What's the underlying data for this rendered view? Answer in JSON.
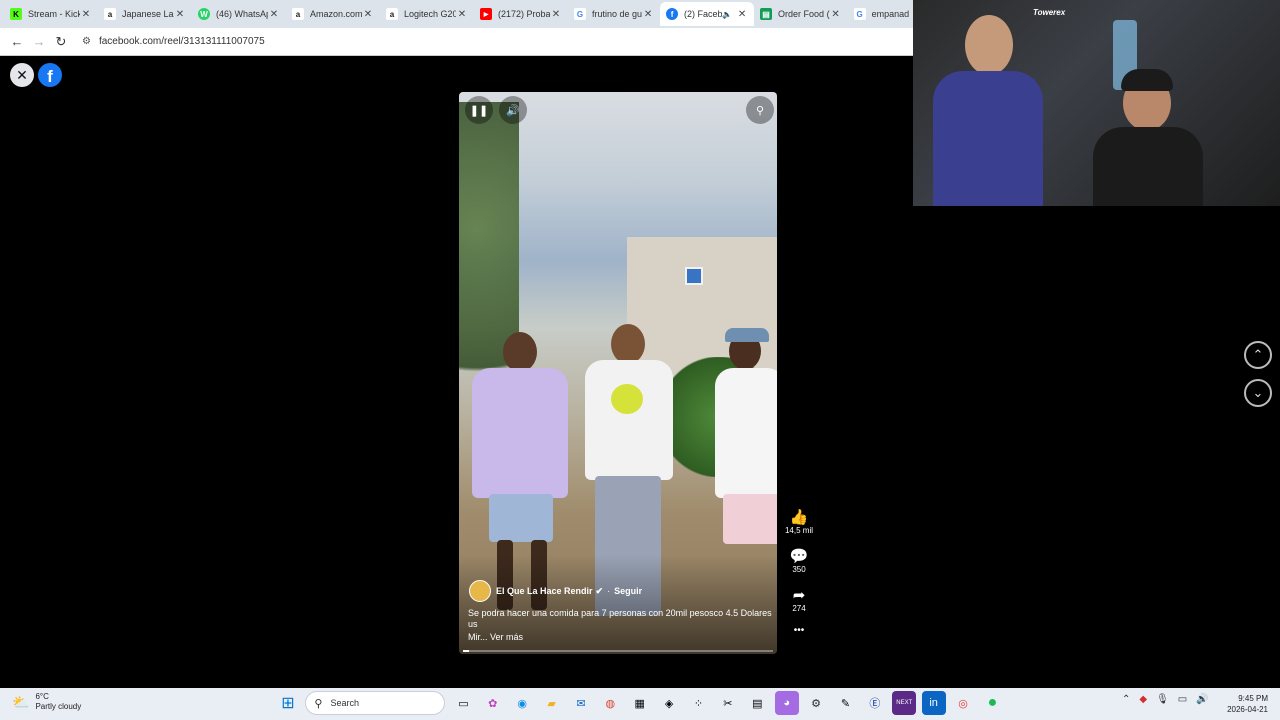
{
  "browser": {
    "tabs": [
      {
        "title": "Stream - Kick",
        "fav": "K",
        "color": "#53fc18",
        "active": false
      },
      {
        "title": "Japanese Lan",
        "fav": "a",
        "color": "#ff9900",
        "active": false
      },
      {
        "title": "(46) WhatsAp",
        "fav": "W",
        "color": "#25d366",
        "active": false
      },
      {
        "title": "Amazon.com",
        "fav": "a",
        "color": "#222222",
        "active": false
      },
      {
        "title": "Logitech G20",
        "fav": "a",
        "color": "#ff9900",
        "active": false
      },
      {
        "title": "(2172) Proba",
        "fav": "▶",
        "color": "#ff0000",
        "active": false
      },
      {
        "title": "frutino de gu",
        "fav": "G",
        "color": "#4285f4",
        "active": false
      },
      {
        "title": "(2) Faceb",
        "fav": "f",
        "color": "#1877f2",
        "active": true
      },
      {
        "title": "Order Food (",
        "fav": "▤",
        "color": "#0f9d58",
        "active": false
      },
      {
        "title": "empanad",
        "fav": "G",
        "color": "#4285f4",
        "active": false
      }
    ],
    "close_glyph": "✕",
    "back_glyph": "←",
    "forward_glyph": "→",
    "reload_glyph": "↻",
    "url": "facebook.com/reel/313131111007075"
  },
  "reel": {
    "author": "El Que La Hace Rendir",
    "follow_label": "Seguir",
    "separator": "·",
    "caption": "Se podra hacer una comida para 7 personas con 20mil pesosco 4.5 Dolares us",
    "more_label": "Mir... Ver más",
    "progress": 0.02
  },
  "actions": {
    "likes": "14,5 mil",
    "comments": "350",
    "shares": "274",
    "more": "•••"
  },
  "webcam": {
    "tag": "Towerex"
  },
  "taskbar": {
    "weather_temp": "6°C",
    "weather_desc": "Partly cloudy",
    "search_label": "Search",
    "time": "9:45 PM",
    "date": "2026-04-21"
  }
}
